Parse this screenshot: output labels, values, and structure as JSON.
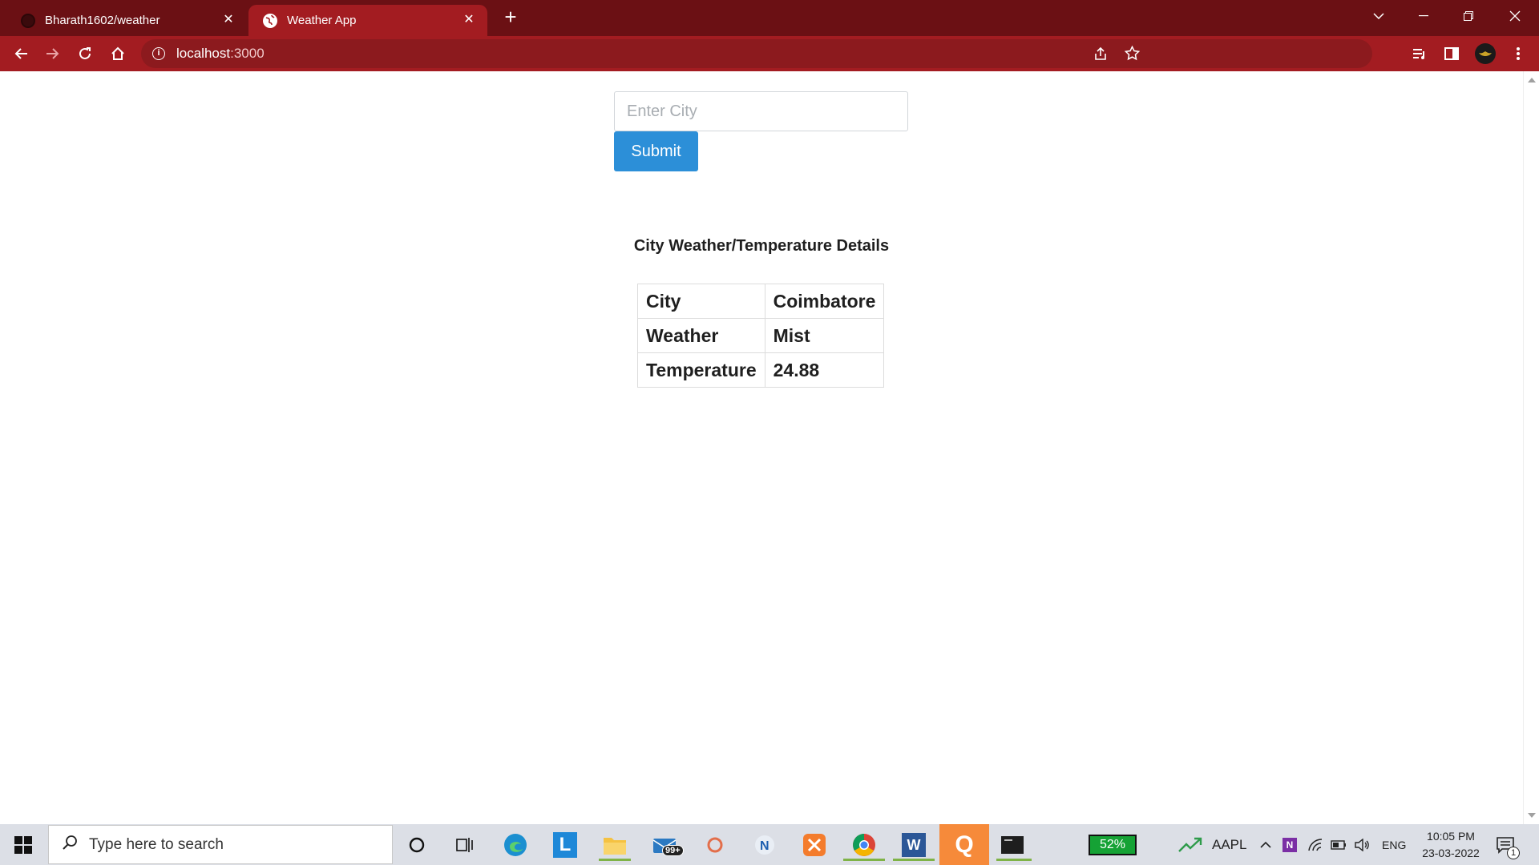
{
  "browser": {
    "tabs": [
      {
        "title": "Bharath1602/weather",
        "active": false
      },
      {
        "title": "Weather App",
        "active": true
      }
    ],
    "address": {
      "host": "localhost",
      "port": ":3000"
    }
  },
  "form": {
    "city_placeholder": "Enter City",
    "submit_label": "Submit"
  },
  "details": {
    "title": "City Weather/Temperature Details",
    "rows": [
      {
        "key": "City",
        "value": "Coimbatore"
      },
      {
        "key": "Weather",
        "value": "Mist"
      },
      {
        "key": "Temperature",
        "value": "24.88"
      }
    ]
  },
  "taskbar": {
    "search_placeholder": "Type here to search",
    "mail_badge": "99+",
    "battery_percent": "52%",
    "stock": "AAPL",
    "language": "ENG",
    "time": "10:05 PM",
    "date": "23-03-2022",
    "notifications": "1"
  },
  "colors": {
    "tab_strip": "#6b1014",
    "toolbar": "#a31c21",
    "submit": "#2c8fd8"
  }
}
